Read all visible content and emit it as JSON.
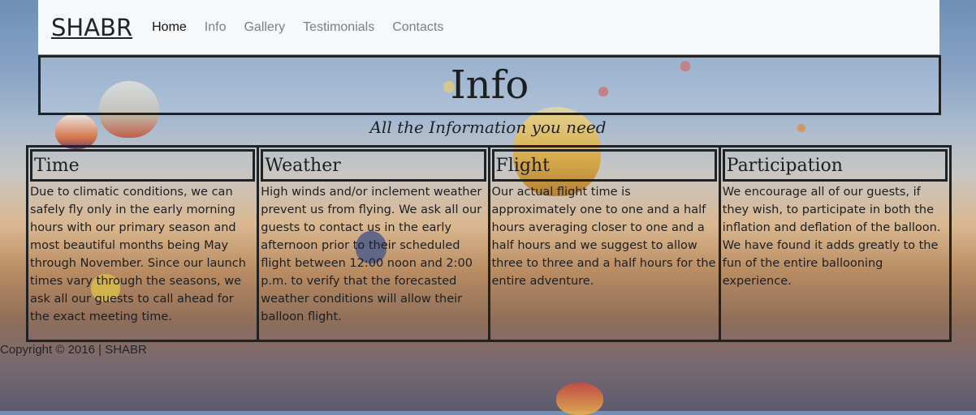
{
  "navbar": {
    "brand": "SHABR",
    "links": [
      "Home",
      "Info",
      "Gallery",
      "Testimonials",
      "Contacts"
    ]
  },
  "hero": {
    "title": "Info"
  },
  "subtitle": "All the Information you need",
  "columns": [
    {
      "title": "Time",
      "body": "Due to climatic conditions, we can safely fly only in the early morning hours with our primary season and most beautiful months being May through November. Since our launch times vary through the seasons, we ask all our guests to call ahead for the exact meeting time."
    },
    {
      "title": "Weather",
      "body": "High winds and/or inclement weather prevent us from flying. We ask all our guests to contact us in the early afternoon prior to their scheduled flight between 12:00 noon and 2:00 p.m. to verify that the forecasted weather conditions will allow their balloon flight."
    },
    {
      "title": "Flight",
      "body": "Our actual flight time is approximately one to one and a half hours averaging closer to one and a half hours and we suggest to allow three to three and a half hours for the entire adventure."
    },
    {
      "title": "Participation",
      "body": "We encourage all of our guests, if they wish, to participate in both the inflation and deflation of the balloon. We have found it adds greatly to the fun of the entire ballooning experience."
    }
  ],
  "footer": "Copyright © 2016 | SHABR",
  "colors": {
    "navbar_bg": "#f7f8fa",
    "border": "#1f2326",
    "text": "#1c1f22"
  }
}
